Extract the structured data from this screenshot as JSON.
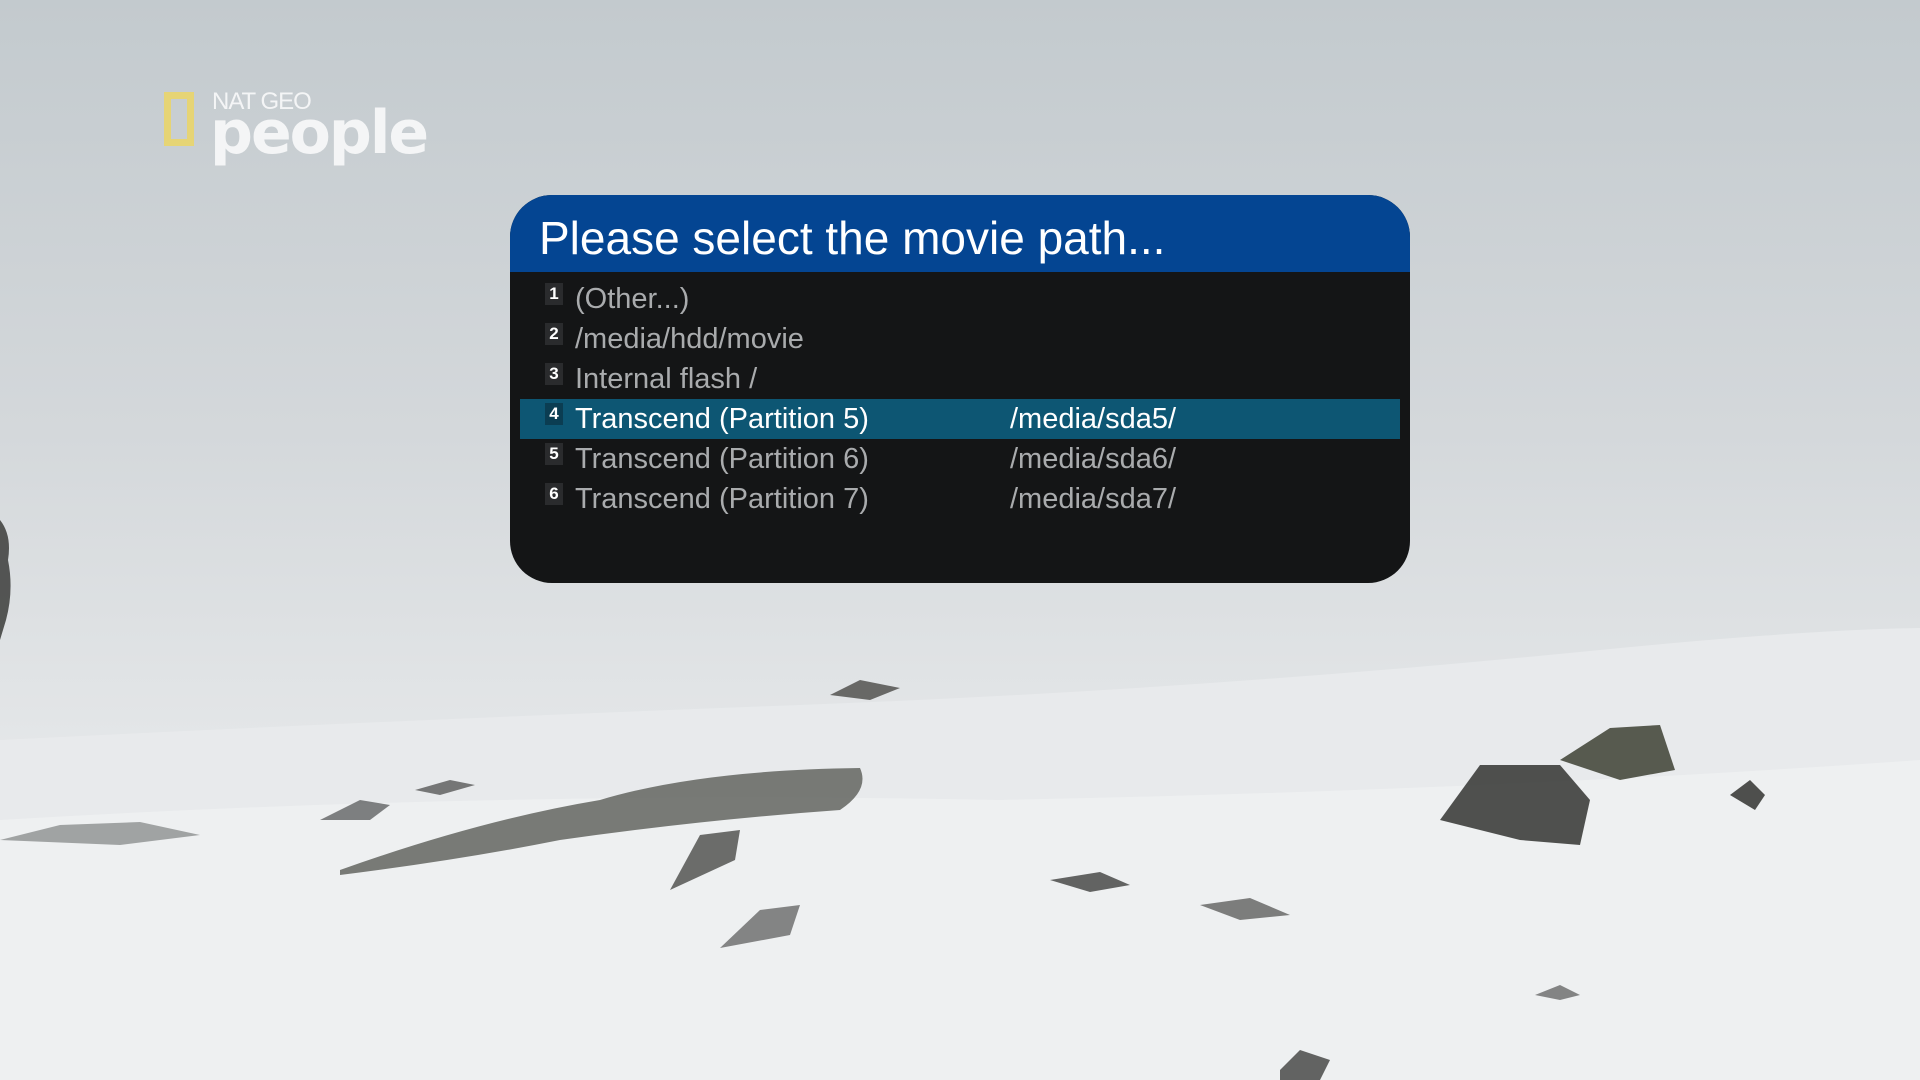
{
  "logo": {
    "small_text": "NAT GEO",
    "main_text": "people"
  },
  "dialog": {
    "title": "Please select the movie path...",
    "items": [
      {
        "number": "1",
        "label": "(Other...)",
        "path": "",
        "selected": false
      },
      {
        "number": "2",
        "label": "/media/hdd/movie",
        "path": "",
        "selected": false
      },
      {
        "number": "3",
        "label": "Internal flash   /",
        "path": "",
        "selected": false
      },
      {
        "number": "4",
        "label": "Transcend (Partition 5)",
        "path": "/media/sda5/",
        "selected": true
      },
      {
        "number": "5",
        "label": "Transcend (Partition 6)",
        "path": "/media/sda6/",
        "selected": false
      },
      {
        "number": "6",
        "label": "Transcend (Partition 7)",
        "path": "/media/sda7/",
        "selected": false
      }
    ]
  },
  "colors": {
    "title_bar": "#044592",
    "dialog_bg": "#141516",
    "selection": "#0d5673",
    "logo_frame": "#e9d56a"
  }
}
